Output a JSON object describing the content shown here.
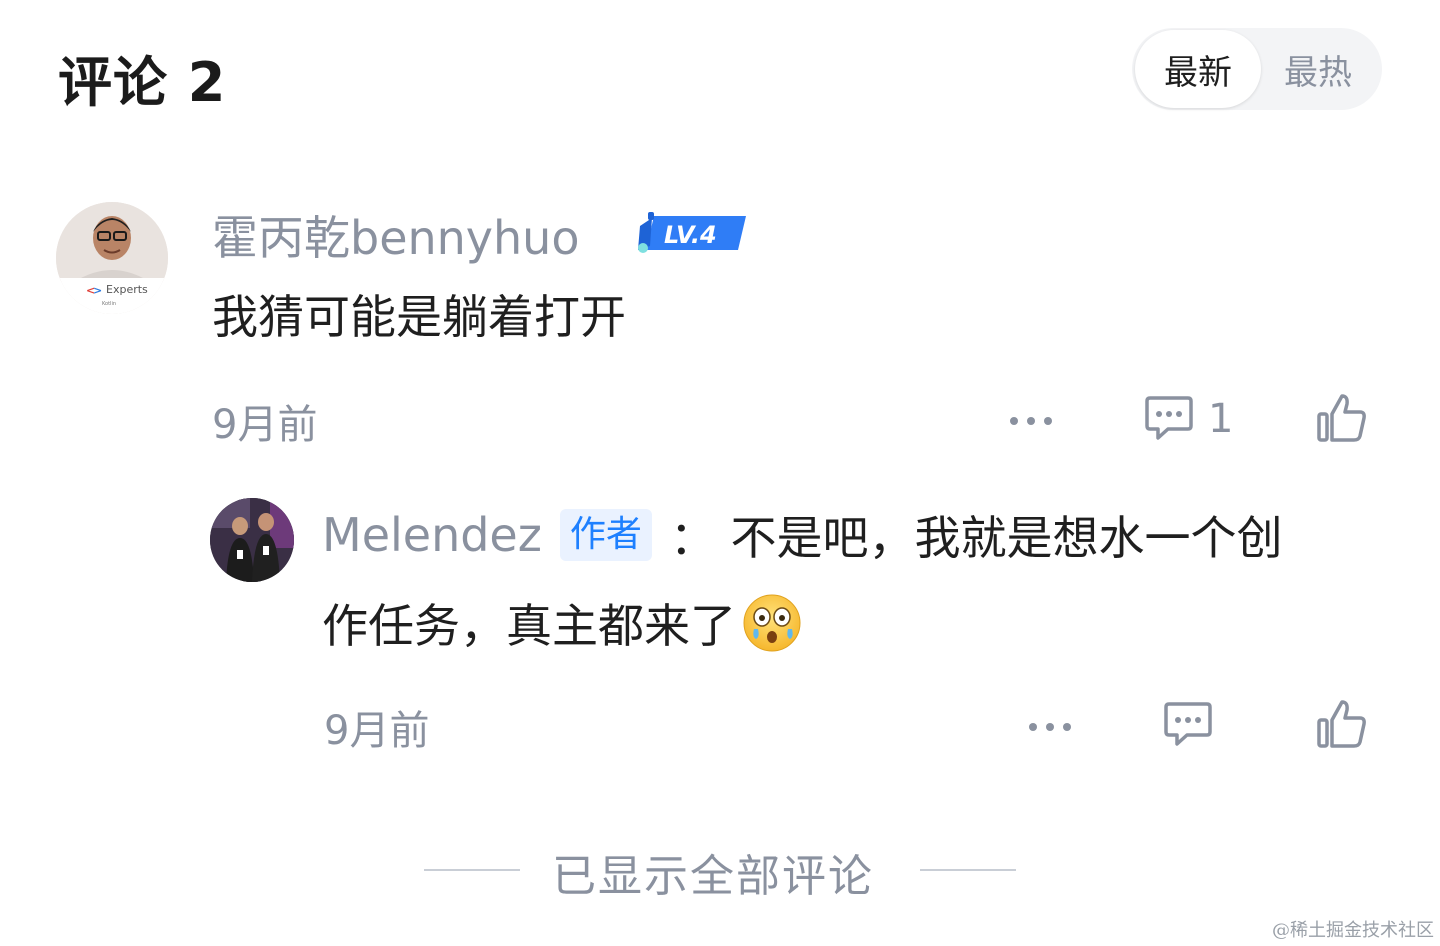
{
  "header": {
    "title": "评论 2",
    "sort_new": "最新",
    "sort_hot": "最热"
  },
  "comment": {
    "username": "霍丙乾bennyhuo",
    "level": "LV.4",
    "avatar_label": "Experts",
    "avatar_sublabel": "Kotlin",
    "text": "我猜可能是躺着打开",
    "time": "9月前",
    "reply_count": "1"
  },
  "reply": {
    "username": "Melendez",
    "author_badge": "作者",
    "text_line1": "： 不是吧，我就是想水一个创",
    "text_line2": "作任务，真主都来了",
    "time": "9月前"
  },
  "footer": {
    "text": "已显示全部评论",
    "watermark": "@稀土掘金技术社区"
  },
  "colors": {
    "accent": "#1e80ff",
    "muted": "#8a919f",
    "text": "#1f1f1f"
  }
}
